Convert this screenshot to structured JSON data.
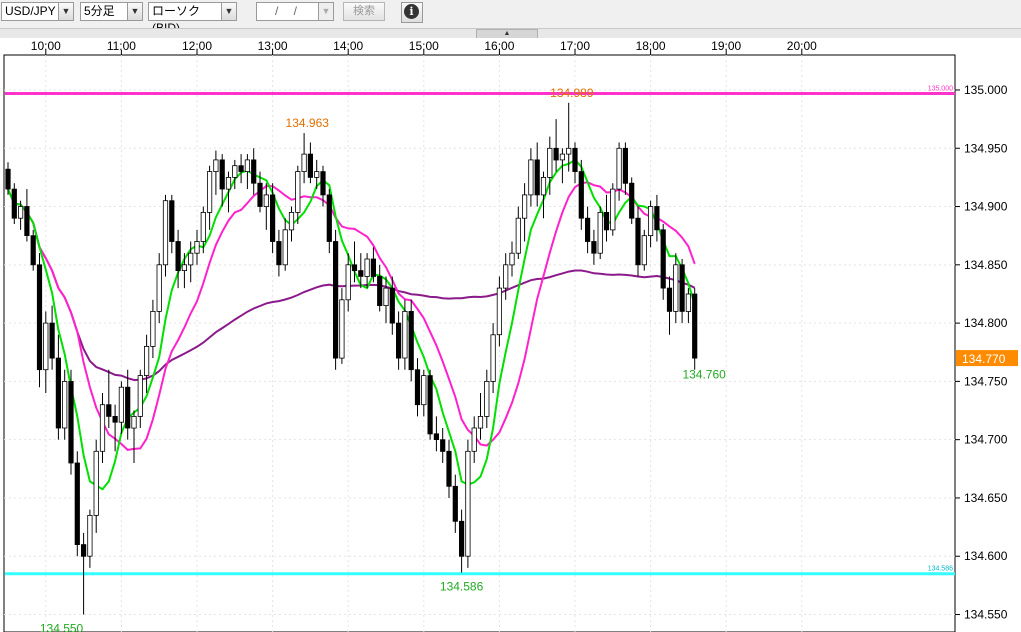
{
  "toolbar": {
    "symbol": "USD/JPY",
    "timeframe": "5分足",
    "chart_type": "ローソク(BID)",
    "date_value": "/ /",
    "search_label": "検索",
    "info_icon": "info-icon",
    "collapse_icon": "triangle-up-icon"
  },
  "colors": {
    "bull_body": "#ffffff",
    "bear_body": "#000000",
    "ma_short": "#00e000",
    "ma_mid": "#ff22cc",
    "ma_long": "#8b1a8b",
    "upper_line": "#ff33cc",
    "lower_line": "#33ffff",
    "current_price_bg": "#ff8c00"
  },
  "chart_data": {
    "type": "candlestick",
    "title": "",
    "x_ticks": [
      "10:00",
      "11:00",
      "12:00",
      "13:00",
      "14:00",
      "15:00",
      "16:00",
      "17:00",
      "18:00",
      "19:00",
      "20:00"
    ],
    "ylim": [
      134.535,
      135.03
    ],
    "y_ticks": [
      "135.000",
      "134.950",
      "134.900",
      "134.850",
      "134.800",
      "134.750",
      "134.700",
      "134.650",
      "134.600",
      "134.550"
    ],
    "current_price": "134.770",
    "upper_line": {
      "value": 134.997,
      "label": "135.000"
    },
    "lower_line": {
      "value": 134.585,
      "label": "134.586"
    },
    "annotations": [
      {
        "text": "134.963",
        "x_index": 47.5,
        "y": 134.963,
        "kind": "high"
      },
      {
        "text": "134.989",
        "x_index": 89.5,
        "y": 134.989,
        "kind": "high"
      },
      {
        "text": "134.550",
        "x_index": 8.5,
        "y": 134.55,
        "kind": "low"
      },
      {
        "text": "134.586",
        "x_index": 72.0,
        "y": 134.586,
        "kind": "low"
      },
      {
        "text": "134.760",
        "x_index": 110.5,
        "y": 134.76,
        "kind": "last"
      }
    ],
    "first_hour_index": 6,
    "candles_per_hour": 12,
    "candles": [
      [
        134.932,
        134.938,
        134.91,
        134.915
      ],
      [
        134.915,
        134.92,
        134.885,
        134.89
      ],
      [
        134.89,
        134.905,
        134.88,
        134.9
      ],
      [
        134.9,
        134.915,
        134.87,
        134.875
      ],
      [
        134.875,
        134.88,
        134.845,
        134.85
      ],
      [
        134.85,
        134.86,
        134.745,
        134.76
      ],
      [
        134.76,
        134.81,
        134.74,
        134.8
      ],
      [
        134.8,
        134.815,
        134.76,
        134.77
      ],
      [
        134.77,
        134.79,
        134.7,
        134.71
      ],
      [
        134.71,
        134.76,
        134.7,
        134.75
      ],
      [
        134.75,
        134.76,
        134.67,
        134.68
      ],
      [
        134.68,
        134.69,
        134.6,
        134.61
      ],
      [
        134.61,
        134.62,
        134.55,
        134.6
      ],
      [
        134.6,
        134.64,
        134.59,
        134.635
      ],
      [
        134.635,
        134.7,
        134.62,
        134.69
      ],
      [
        134.69,
        134.74,
        134.68,
        134.73
      ],
      [
        134.73,
        134.76,
        134.71,
        134.72
      ],
      [
        134.72,
        134.73,
        134.69,
        134.715
      ],
      [
        134.715,
        134.75,
        134.705,
        134.745
      ],
      [
        134.745,
        134.76,
        134.7,
        134.71
      ],
      [
        134.71,
        134.725,
        134.68,
        134.72
      ],
      [
        134.72,
        134.76,
        134.71,
        134.755
      ],
      [
        134.755,
        134.79,
        134.74,
        134.78
      ],
      [
        134.78,
        134.82,
        134.77,
        134.81
      ],
      [
        134.81,
        134.86,
        134.8,
        134.85
      ],
      [
        134.85,
        134.91,
        134.84,
        134.905
      ],
      [
        134.905,
        134.91,
        134.86,
        134.87
      ],
      [
        134.87,
        134.88,
        134.83,
        134.845
      ],
      [
        134.845,
        134.86,
        134.83,
        134.85
      ],
      [
        134.85,
        134.87,
        134.835,
        134.86
      ],
      [
        134.86,
        134.88,
        134.85,
        134.87
      ],
      [
        134.87,
        134.9,
        134.86,
        134.895
      ],
      [
        134.895,
        134.935,
        134.88,
        134.93
      ],
      [
        134.93,
        134.948,
        134.91,
        134.94
      ],
      [
        134.94,
        134.945,
        134.9,
        134.915
      ],
      [
        134.915,
        134.93,
        134.895,
        134.925
      ],
      [
        134.925,
        134.94,
        134.915,
        134.935
      ],
      [
        134.935,
        134.945,
        134.92,
        134.93
      ],
      [
        134.93,
        134.945,
        134.915,
        134.94
      ],
      [
        134.94,
        134.95,
        134.91,
        134.92
      ],
      [
        134.92,
        134.93,
        134.895,
        134.9
      ],
      [
        134.9,
        134.92,
        134.88,
        134.91
      ],
      [
        134.91,
        134.92,
        134.86,
        134.87
      ],
      [
        134.87,
        134.88,
        134.84,
        134.85
      ],
      [
        134.85,
        134.89,
        134.845,
        134.88
      ],
      [
        134.88,
        134.9,
        134.87,
        134.895
      ],
      [
        134.895,
        134.935,
        134.885,
        134.93
      ],
      [
        134.93,
        134.963,
        134.92,
        134.945
      ],
      [
        134.945,
        134.955,
        134.92,
        134.925
      ],
      [
        134.925,
        134.94,
        134.915,
        134.93
      ],
      [
        134.93,
        134.935,
        134.9,
        134.91
      ],
      [
        134.91,
        134.915,
        134.86,
        134.87
      ],
      [
        134.87,
        134.88,
        134.76,
        134.77
      ],
      [
        134.77,
        134.83,
        134.765,
        134.82
      ],
      [
        134.82,
        134.86,
        134.81,
        134.85
      ],
      [
        134.85,
        134.87,
        134.835,
        134.845
      ],
      [
        134.845,
        134.86,
        134.83,
        134.84
      ],
      [
        134.84,
        134.86,
        134.83,
        134.855
      ],
      [
        134.855,
        134.865,
        134.835,
        134.84
      ],
      [
        134.84,
        134.85,
        134.81,
        134.815
      ],
      [
        134.815,
        134.84,
        134.8,
        134.83
      ],
      [
        134.83,
        134.84,
        134.79,
        134.8
      ],
      [
        134.8,
        134.81,
        134.76,
        134.77
      ],
      [
        134.77,
        134.82,
        134.76,
        134.81
      ],
      [
        134.81,
        134.82,
        134.75,
        134.76
      ],
      [
        134.76,
        134.77,
        134.72,
        134.73
      ],
      [
        134.73,
        134.76,
        134.72,
        134.755
      ],
      [
        134.755,
        134.76,
        134.7,
        134.705
      ],
      [
        134.705,
        134.72,
        134.69,
        134.7
      ],
      [
        134.7,
        134.71,
        134.68,
        134.69
      ],
      [
        134.69,
        134.7,
        134.65,
        134.66
      ],
      [
        134.66,
        134.67,
        134.62,
        134.63
      ],
      [
        134.63,
        134.64,
        134.586,
        134.6
      ],
      [
        134.6,
        134.7,
        134.59,
        134.69
      ],
      [
        134.69,
        134.72,
        134.68,
        134.71
      ],
      [
        134.71,
        134.74,
        134.7,
        134.72
      ],
      [
        134.72,
        134.76,
        134.71,
        134.75
      ],
      [
        134.75,
        134.8,
        134.74,
        134.79
      ],
      [
        134.79,
        134.84,
        134.78,
        134.83
      ],
      [
        134.83,
        134.86,
        134.82,
        134.85
      ],
      [
        134.85,
        134.87,
        134.84,
        134.86
      ],
      [
        134.86,
        134.9,
        134.855,
        134.89
      ],
      [
        134.89,
        134.92,
        134.87,
        134.91
      ],
      [
        134.91,
        134.95,
        134.9,
        134.94
      ],
      [
        134.94,
        134.955,
        134.9,
        134.91
      ],
      [
        134.91,
        134.93,
        134.89,
        134.925
      ],
      [
        134.925,
        134.96,
        134.91,
        134.95
      ],
      [
        134.95,
        134.975,
        134.93,
        134.94
      ],
      [
        134.94,
        134.95,
        134.92,
        134.945
      ],
      [
        134.945,
        134.989,
        134.93,
        134.95
      ],
      [
        134.95,
        134.955,
        134.92,
        134.93
      ],
      [
        134.93,
        134.94,
        134.88,
        134.89
      ],
      [
        134.89,
        134.9,
        134.86,
        134.87
      ],
      [
        134.87,
        134.88,
        134.85,
        134.86
      ],
      [
        134.86,
        134.9,
        134.855,
        134.895
      ],
      [
        134.895,
        134.91,
        134.87,
        134.88
      ],
      [
        134.88,
        134.92,
        134.875,
        134.915
      ],
      [
        134.915,
        134.955,
        134.905,
        134.95
      ],
      [
        134.95,
        134.955,
        134.91,
        134.92
      ],
      [
        134.92,
        134.925,
        134.885,
        134.89
      ],
      [
        134.89,
        134.9,
        134.84,
        134.85
      ],
      [
        134.85,
        134.88,
        134.845,
        134.875
      ],
      [
        134.875,
        134.905,
        134.865,
        134.9
      ],
      [
        134.9,
        134.91,
        134.87,
        134.88
      ],
      [
        134.88,
        134.885,
        134.82,
        134.83
      ],
      [
        134.83,
        134.84,
        134.79,
        134.81
      ],
      [
        134.81,
        134.86,
        134.8,
        134.85
      ],
      [
        134.85,
        134.855,
        134.8,
        134.81
      ],
      [
        134.81,
        134.83,
        134.8,
        134.825
      ],
      [
        134.825,
        134.83,
        134.76,
        134.77
      ]
    ]
  }
}
